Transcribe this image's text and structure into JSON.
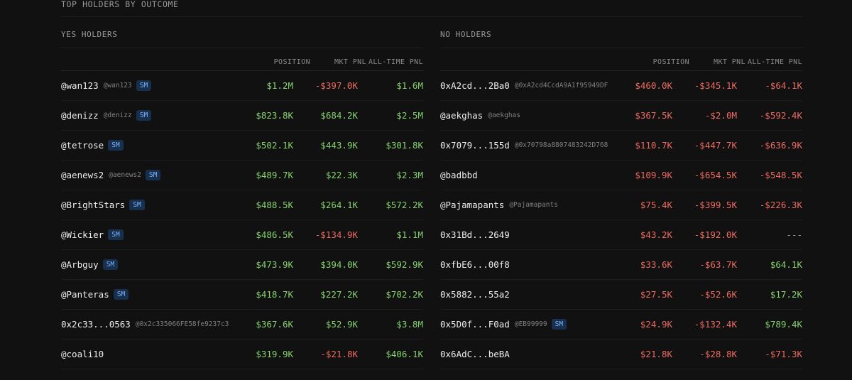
{
  "section_title": "TOP HOLDERS BY OUTCOME",
  "columns": {
    "position": "POSITION",
    "mkt_pnl": "MKT PNL",
    "all_time_pnl": "ALL-TIME PNL"
  },
  "colors": {
    "positive": "#86d16e",
    "negative": "#ee6a60",
    "badge_bg": "#16304d",
    "badge_text": "#7fb2ff"
  },
  "yes": {
    "title": "YES HOLDERS",
    "rows": [
      {
        "name": "@wan123",
        "handle": "@wan123",
        "badge": "SM",
        "position": "$1.2M",
        "mkt_pnl": "-$397.0K",
        "all_time_pnl": "$1.6M",
        "pos_tone": "green",
        "mkt_tone": "red",
        "all_tone": "green"
      },
      {
        "name": "@denizz",
        "handle": "@denizz",
        "badge": "SM",
        "position": "$823.8K",
        "mkt_pnl": "$684.2K",
        "all_time_pnl": "$2.5M",
        "pos_tone": "green",
        "mkt_tone": "green",
        "all_tone": "green"
      },
      {
        "name": "@tetrose",
        "handle": "",
        "badge": "SM",
        "position": "$502.1K",
        "mkt_pnl": "$443.9K",
        "all_time_pnl": "$301.8K",
        "pos_tone": "green",
        "mkt_tone": "green",
        "all_tone": "green"
      },
      {
        "name": "@aenews2",
        "handle": "@aenews2",
        "badge": "SM",
        "position": "$489.7K",
        "mkt_pnl": "$22.3K",
        "all_time_pnl": "$2.3M",
        "pos_tone": "green",
        "mkt_tone": "green",
        "all_tone": "green"
      },
      {
        "name": "@BrightStars",
        "handle": "",
        "badge": "SM",
        "position": "$488.5K",
        "mkt_pnl": "$264.1K",
        "all_time_pnl": "$572.2K",
        "pos_tone": "green",
        "mkt_tone": "green",
        "all_tone": "green"
      },
      {
        "name": "@Wickier",
        "handle": "",
        "badge": "SM",
        "position": "$486.5K",
        "mkt_pnl": "-$134.9K",
        "all_time_pnl": "$1.1M",
        "pos_tone": "green",
        "mkt_tone": "red",
        "all_tone": "green"
      },
      {
        "name": "@Arbguy",
        "handle": "",
        "badge": "SM",
        "position": "$473.9K",
        "mkt_pnl": "$394.0K",
        "all_time_pnl": "$592.9K",
        "pos_tone": "green",
        "mkt_tone": "green",
        "all_tone": "green"
      },
      {
        "name": "@Panteras",
        "handle": "",
        "badge": "SM",
        "position": "$418.7K",
        "mkt_pnl": "$227.2K",
        "all_time_pnl": "$702.2K",
        "pos_tone": "green",
        "mkt_tone": "green",
        "all_tone": "green"
      },
      {
        "name": "0x2c33...0563",
        "handle": "@0x2c335066FE58fe9237c3",
        "badge": "",
        "position": "$367.6K",
        "mkt_pnl": "$52.9K",
        "all_time_pnl": "$3.8M",
        "pos_tone": "green",
        "mkt_tone": "green",
        "all_tone": "green"
      },
      {
        "name": "@coali10",
        "handle": "",
        "badge": "",
        "position": "$319.9K",
        "mkt_pnl": "-$21.8K",
        "all_time_pnl": "$406.1K",
        "pos_tone": "green",
        "mkt_tone": "red",
        "all_tone": "green"
      }
    ]
  },
  "no": {
    "title": "NO HOLDERS",
    "rows": [
      {
        "name": "0xA2cd...2Ba0",
        "handle": "@0xA2cd4CcdA9A1f95949DF",
        "badge": "",
        "position": "$460.0K",
        "mkt_pnl": "-$345.1K",
        "all_time_pnl": "-$64.1K",
        "pos_tone": "red",
        "mkt_tone": "red",
        "all_tone": "red"
      },
      {
        "name": "@aekghas",
        "handle": "@aekghas",
        "badge": "",
        "position": "$367.5K",
        "mkt_pnl": "-$2.0M",
        "all_time_pnl": "-$592.4K",
        "pos_tone": "red",
        "mkt_tone": "red",
        "all_tone": "red"
      },
      {
        "name": "0x7079...155d",
        "handle": "@0x70798a8807483242D768",
        "badge": "",
        "position": "$110.7K",
        "mkt_pnl": "-$447.7K",
        "all_time_pnl": "-$636.9K",
        "pos_tone": "red",
        "mkt_tone": "red",
        "all_tone": "red"
      },
      {
        "name": "@badbbd",
        "handle": "",
        "badge": "",
        "position": "$109.9K",
        "mkt_pnl": "-$654.5K",
        "all_time_pnl": "-$548.5K",
        "pos_tone": "red",
        "mkt_tone": "red",
        "all_tone": "red"
      },
      {
        "name": "@Pajamapants",
        "handle": "@Pajamapants",
        "badge": "",
        "position": "$75.4K",
        "mkt_pnl": "-$399.5K",
        "all_time_pnl": "-$226.3K",
        "pos_tone": "red",
        "mkt_tone": "red",
        "all_tone": "red"
      },
      {
        "name": "0x31Bd...2649",
        "handle": "",
        "badge": "",
        "position": "$43.2K",
        "mkt_pnl": "-$192.0K",
        "all_time_pnl": "---",
        "pos_tone": "red",
        "mkt_tone": "red",
        "all_tone": "neutral"
      },
      {
        "name": "0xfbE6...00f8",
        "handle": "",
        "badge": "",
        "position": "$33.6K",
        "mkt_pnl": "-$63.7K",
        "all_time_pnl": "$64.1K",
        "pos_tone": "red",
        "mkt_tone": "red",
        "all_tone": "green"
      },
      {
        "name": "0x5882...55a2",
        "handle": "",
        "badge": "",
        "position": "$27.5K",
        "mkt_pnl": "-$52.6K",
        "all_time_pnl": "$17.2K",
        "pos_tone": "red",
        "mkt_tone": "red",
        "all_tone": "green"
      },
      {
        "name": "0x5D0f...F0ad",
        "handle": "@EB99999",
        "badge": "SM",
        "position": "$24.9K",
        "mkt_pnl": "-$132.4K",
        "all_time_pnl": "$789.4K",
        "pos_tone": "red",
        "mkt_tone": "red",
        "all_tone": "green"
      },
      {
        "name": "0x6AdC...beBA",
        "handle": "",
        "badge": "",
        "position": "$21.8K",
        "mkt_pnl": "-$28.8K",
        "all_time_pnl": "-$71.3K",
        "pos_tone": "red",
        "mkt_tone": "red",
        "all_tone": "red"
      }
    ]
  }
}
